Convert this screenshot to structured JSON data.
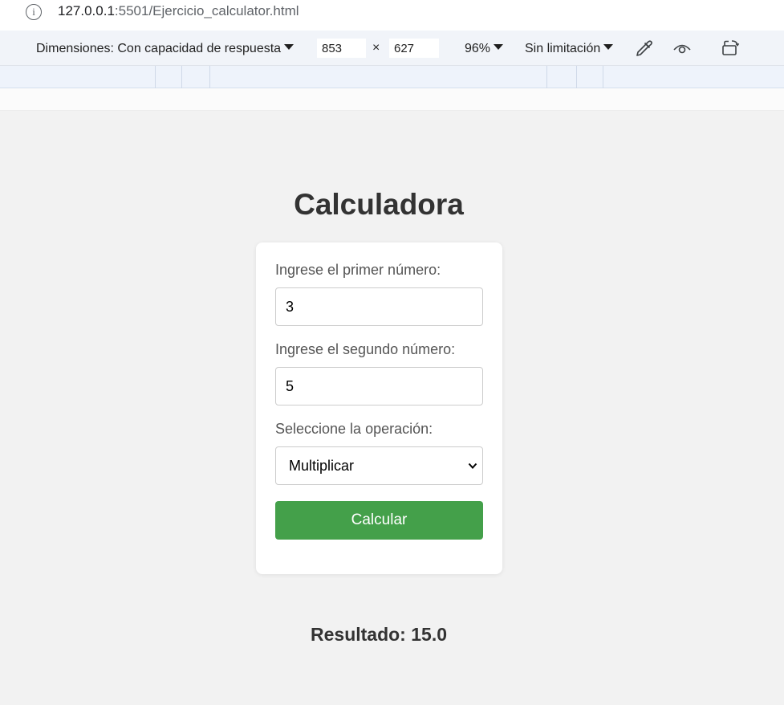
{
  "browser": {
    "url_host": "127.0.0.1",
    "url_rest": ":5501/Ejercicio_calculator.html"
  },
  "devtools": {
    "dimensions_label": "Dimensiones: Con capacidad de respuesta",
    "width_value": "853",
    "times_symbol": "×",
    "height_value": "627",
    "zoom_label": "96%",
    "throttle_label": "Sin limitación",
    "icons": [
      "info-icon",
      "eyedropper-icon",
      "eye-icon",
      "rotate-icon"
    ]
  },
  "page": {
    "title": "Calculadora",
    "first_label": "Ingrese el primer número:",
    "first_value": "3",
    "second_label": "Ingrese el segundo número:",
    "second_value": "5",
    "operation_label": "Seleccione la operación:",
    "operation_selected": "Multiplicar",
    "button_label": "Calcular",
    "result_text": "Resultado: 15.0"
  },
  "colors": {
    "page_background": "#f2f2f2",
    "button": "#44a04a",
    "text": "#333333"
  }
}
